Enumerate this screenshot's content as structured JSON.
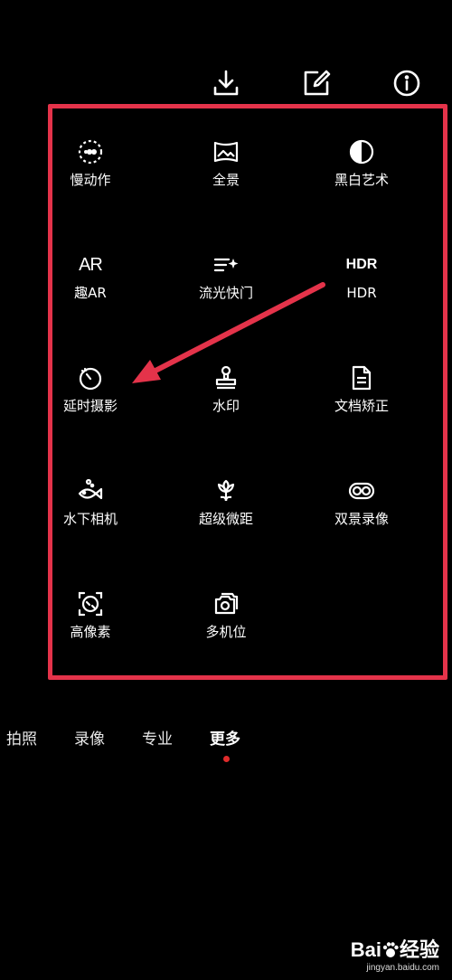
{
  "toolbar": {
    "download_icon": "download-icon",
    "edit_icon": "edit-icon",
    "info_icon": "info-icon"
  },
  "modes": [
    {
      "label": "慢动作",
      "icon": "slow-motion-icon"
    },
    {
      "label": "全景",
      "icon": "panorama-icon"
    },
    {
      "label": "黑白艺术",
      "icon": "monochrome-icon"
    },
    {
      "label": "趣AR",
      "icon": "ar-icon",
      "icon_text": "AR"
    },
    {
      "label": "流光快门",
      "icon": "light-painting-icon"
    },
    {
      "label": "HDR",
      "icon": "hdr-icon",
      "icon_text": "HDR"
    },
    {
      "label": "延时摄影",
      "icon": "time-lapse-icon"
    },
    {
      "label": "水印",
      "icon": "watermark-stamp-icon"
    },
    {
      "label": "文档矫正",
      "icon": "document-icon"
    },
    {
      "label": "水下相机",
      "icon": "underwater-fish-icon"
    },
    {
      "label": "超级微距",
      "icon": "super-macro-icon"
    },
    {
      "label": "双景录像",
      "icon": "dual-view-icon"
    },
    {
      "label": "高像素",
      "icon": "high-resolution-icon"
    },
    {
      "label": "多机位",
      "icon": "multi-camera-icon"
    }
  ],
  "tabs": [
    {
      "label": "拍照"
    },
    {
      "label": "录像"
    },
    {
      "label": "专业"
    },
    {
      "label": "更多",
      "active": true
    }
  ],
  "annotation": {
    "color": "#e4334a"
  },
  "watermark": {
    "logo_left": "Bai",
    "logo_right": "经验",
    "url": "jingyan.baidu.com"
  }
}
